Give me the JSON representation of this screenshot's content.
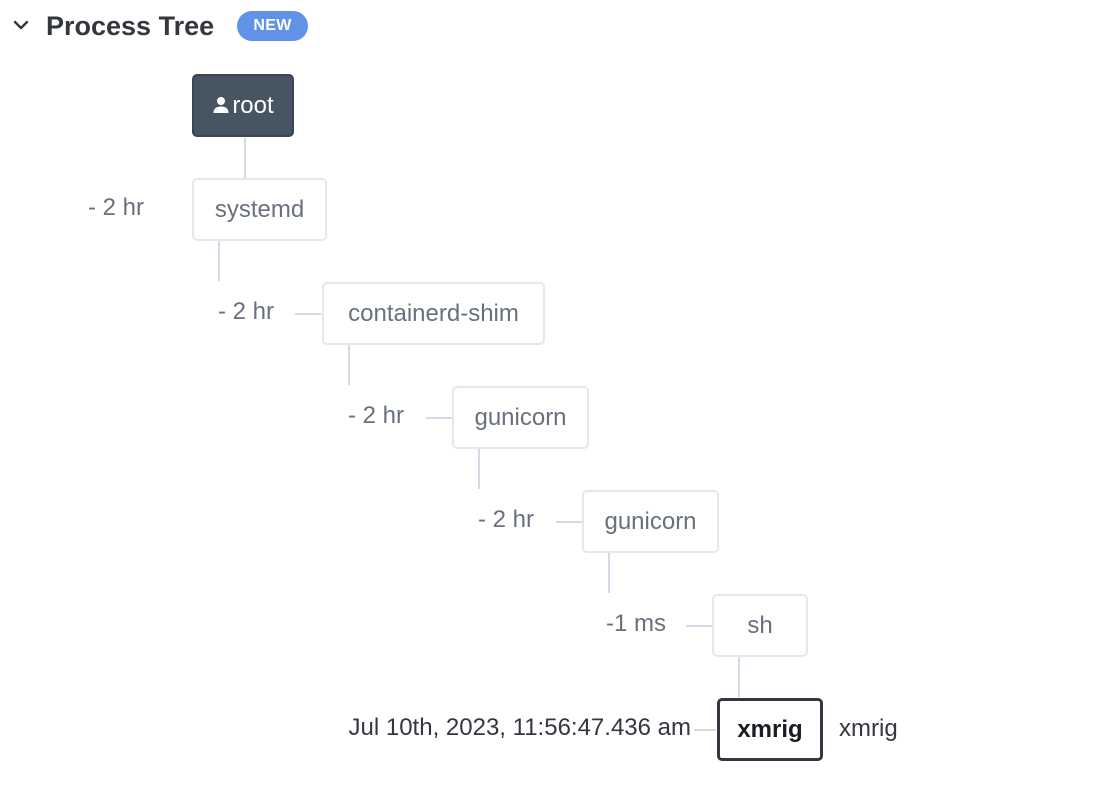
{
  "header": {
    "title": "Process Tree",
    "badge": "NEW",
    "toggle_icon": "chevron-down-icon"
  },
  "tree": {
    "root": {
      "label": "root",
      "icon": "user-icon"
    },
    "nodes": [
      {
        "label": "systemd",
        "time": "- 2 hr"
      },
      {
        "label": "containerd-shim",
        "time": "- 2 hr"
      },
      {
        "label": "gunicorn",
        "time": "- 2 hr"
      },
      {
        "label": "gunicorn",
        "time": "- 2 hr"
      },
      {
        "label": "sh",
        "time": "-1 ms"
      }
    ],
    "selected": {
      "label": "xmrig",
      "timestamp": "Jul 10th, 2023, 11:56:47.436 am",
      "detail": "xmrig"
    }
  },
  "colors": {
    "badge": "#6092e8",
    "root_node": "#475462",
    "title": "#343741",
    "muted_text": "#69707d",
    "connector": "#d3dae6"
  }
}
